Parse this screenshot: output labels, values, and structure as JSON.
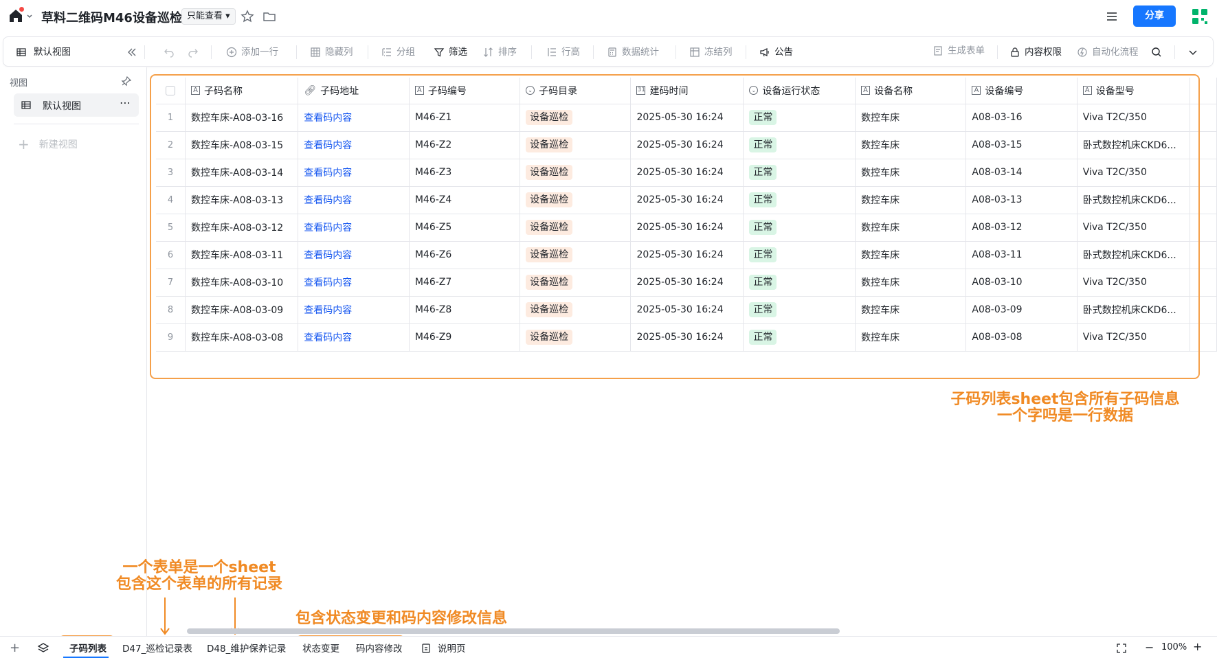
{
  "header": {
    "title": "草料二维码M46设备巡检",
    "permission": "只能查看",
    "share_label": "分享"
  },
  "toolbar": {
    "view_name": "默认视图",
    "add_row": "添加一行",
    "hide_cols": "隐藏列",
    "group": "分组",
    "filter": "筛选",
    "sort": "排序",
    "row_height": "行高",
    "stats": "数据统计",
    "freeze": "冻结列",
    "notice": "公告",
    "gen_form": "生成表单",
    "content_perm": "内容权限",
    "automation": "自动化流程"
  },
  "sidebar": {
    "section_label": "视图",
    "view_item": "默认视图",
    "new_view": "新建视图"
  },
  "table": {
    "columns": [
      "子码名称",
      "子码地址",
      "子码编号",
      "子码目录",
      "建码时间",
      "设备运行状态",
      "设备名称",
      "设备编号",
      "设备型号"
    ],
    "rows": [
      {
        "num": "1",
        "name": "数控车床-A08-03-16",
        "addr": "查看码内容",
        "code": "M46-Z1",
        "dir": "设备巡检",
        "time": "2025-05-30 16:24",
        "status": "正常",
        "device": "数控车床",
        "devno": "A08-03-16",
        "model": "Viva T2C/350"
      },
      {
        "num": "2",
        "name": "数控车床-A08-03-15",
        "addr": "查看码内容",
        "code": "M46-Z2",
        "dir": "设备巡检",
        "time": "2025-05-30 16:24",
        "status": "正常",
        "device": "数控车床",
        "devno": "A08-03-15",
        "model": "卧式数控机床CKD6..."
      },
      {
        "num": "3",
        "name": "数控车床-A08-03-14",
        "addr": "查看码内容",
        "code": "M46-Z3",
        "dir": "设备巡检",
        "time": "2025-05-30 16:24",
        "status": "正常",
        "device": "数控车床",
        "devno": "A08-03-14",
        "model": "Viva T2C/350"
      },
      {
        "num": "4",
        "name": "数控车床-A08-03-13",
        "addr": "查看码内容",
        "code": "M46-Z4",
        "dir": "设备巡检",
        "time": "2025-05-30 16:24",
        "status": "正常",
        "device": "数控车床",
        "devno": "A08-03-13",
        "model": "卧式数控机床CKD6..."
      },
      {
        "num": "5",
        "name": "数控车床-A08-03-12",
        "addr": "查看码内容",
        "code": "M46-Z5",
        "dir": "设备巡检",
        "time": "2025-05-30 16:24",
        "status": "正常",
        "device": "数控车床",
        "devno": "A08-03-12",
        "model": "Viva T2C/350"
      },
      {
        "num": "6",
        "name": "数控车床-A08-03-11",
        "addr": "查看码内容",
        "code": "M46-Z6",
        "dir": "设备巡检",
        "time": "2025-05-30 16:24",
        "status": "正常",
        "device": "数控车床",
        "devno": "A08-03-11",
        "model": "卧式数控机床CKD6..."
      },
      {
        "num": "7",
        "name": "数控车床-A08-03-10",
        "addr": "查看码内容",
        "code": "M46-Z7",
        "dir": "设备巡检",
        "time": "2025-05-30 16:24",
        "status": "正常",
        "device": "数控车床",
        "devno": "A08-03-10",
        "model": "Viva T2C/350"
      },
      {
        "num": "8",
        "name": "数控车床-A08-03-09",
        "addr": "查看码内容",
        "code": "M46-Z8",
        "dir": "设备巡检",
        "time": "2025-05-30 16:24",
        "status": "正常",
        "device": "数控车床",
        "devno": "A08-03-09",
        "model": "卧式数控机床CKD6..."
      },
      {
        "num": "9",
        "name": "数控车床-A08-03-08",
        "addr": "查看码内容",
        "code": "M46-Z9",
        "dir": "设备巡检",
        "time": "2025-05-30 16:24",
        "status": "正常",
        "device": "数控车床",
        "devno": "A08-03-08",
        "model": "Viva T2C/350"
      }
    ]
  },
  "annotations": {
    "right_line1": "子码列表sheet包含所有子码信息",
    "right_line2": "一个字吗是一行数据",
    "left_line1": "一个表单是一个sheet",
    "left_line2": "包含这个表单的所有记录",
    "bottom": "包含状态变更和码内容修改信息"
  },
  "sheets": {
    "tabs": [
      "子码列表",
      "D47_巡检记录表",
      "D48_维护保养记录",
      "状态变更",
      "码内容修改",
      "说明页"
    ],
    "zoom": "100%"
  },
  "colors": {
    "accent": "#1677ff",
    "annotation": "#f08a24",
    "link": "#1456f0",
    "tag_orange_bg": "#fdebe0",
    "tag_green_bg": "#d9f5e5"
  }
}
